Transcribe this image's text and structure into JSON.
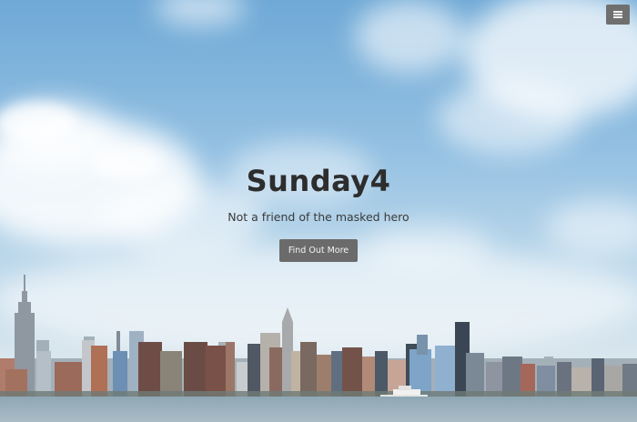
{
  "site": {
    "title": "Sunday4",
    "tagline": "Not a friend of the masked hero"
  },
  "hero": {
    "cta_label": "Find Out More"
  },
  "header": {
    "menu_icon": "hamburger-menu-icon"
  },
  "colors": {
    "sky_top": "#6fa9d6",
    "button_bg": "#6b6b6b",
    "title_color": "#2d2d2d",
    "water": "#8ea6b3"
  }
}
